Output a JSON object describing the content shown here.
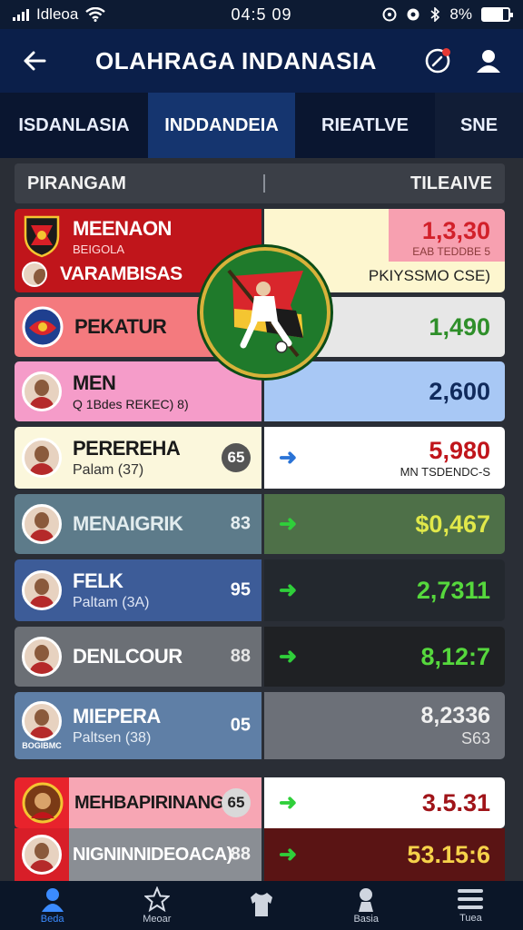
{
  "status_bar": {
    "carrier": "Idleoa",
    "time": "04:5 09",
    "battery": "8%",
    "battery_level": 0.8
  },
  "header": {
    "title": "OLAHRAGA INDANASIA"
  },
  "tabs": [
    {
      "label": "ISDANLASIA",
      "active": false
    },
    {
      "label": "INDDANDEIA",
      "active": true
    },
    {
      "label": "RIEATLVE",
      "active": false
    },
    {
      "label": "SNЕ",
      "active": false
    }
  ],
  "filter": {
    "left_label": "PIRANGAM",
    "right_label": "TILEAIVE"
  },
  "rows": [
    {
      "name": "MEENAON",
      "sub": "BEIGOLA",
      "badge": "",
      "value": "1,3,30",
      "value_sub": "EAB TEDDBE 5"
    },
    {
      "name": "VARAMBISAS",
      "sub": "",
      "badge": "",
      "value": "",
      "value_sub": "PKIYSSMO CSE)"
    },
    {
      "name": "PEKATUR",
      "sub": "",
      "badge": "",
      "value": "1,490",
      "value_sub": ""
    },
    {
      "name": "MEN",
      "sub": "Q 1Bdes REKEC) 8)",
      "badge": "",
      "value": "2,600",
      "value_sub": ""
    },
    {
      "name": "PEREREHA",
      "sub": "Palam (37)",
      "badge": "65",
      "value": "5,980",
      "value_sub": "MN TSDENDC-S"
    },
    {
      "name": "MENAIGRIK",
      "sub": "",
      "badge": "83",
      "value": "$0,467",
      "value_sub": ""
    },
    {
      "name": "FELK",
      "sub": "Paltam (3A)",
      "badge": "95",
      "value": "2,7311",
      "value_sub": ""
    },
    {
      "name": "DENLCOUR",
      "sub": "",
      "badge": "88",
      "value": "8,12:7",
      "value_sub": ""
    },
    {
      "name": "MIEPERA",
      "sub": "Paltsen (38)",
      "badge": "05",
      "value": "8,2336",
      "value_sub": "S63"
    },
    {
      "name": "MEHBAPIRINANG",
      "sub": "",
      "badge": "65",
      "value": "3.5.31",
      "value_sub": ""
    },
    {
      "name": "NIGNINNIDEOACA)",
      "sub": "",
      "badge": "88",
      "value": "53.15:6",
      "value_sub": ""
    }
  ],
  "row_extra": {
    "avatar_label": "BOGIBMC"
  },
  "bottom_nav": [
    {
      "label": "Beda",
      "icon": "person-icon",
      "active": true
    },
    {
      "label": "Meoar",
      "icon": "star-icon",
      "active": false
    },
    {
      "label": "",
      "icon": "jersey-icon",
      "active": false
    },
    {
      "label": "Basia",
      "icon": "player-icon",
      "active": false
    },
    {
      "label": "Tuea",
      "icon": "menu-icon",
      "active": false
    }
  ],
  "colors": {
    "header_bg": "#0b1f4a",
    "active_tab": "#15356f",
    "accent_green": "#2fcf3a",
    "accent_red": "#c0151b",
    "accent_blue": "#3b8bff"
  }
}
